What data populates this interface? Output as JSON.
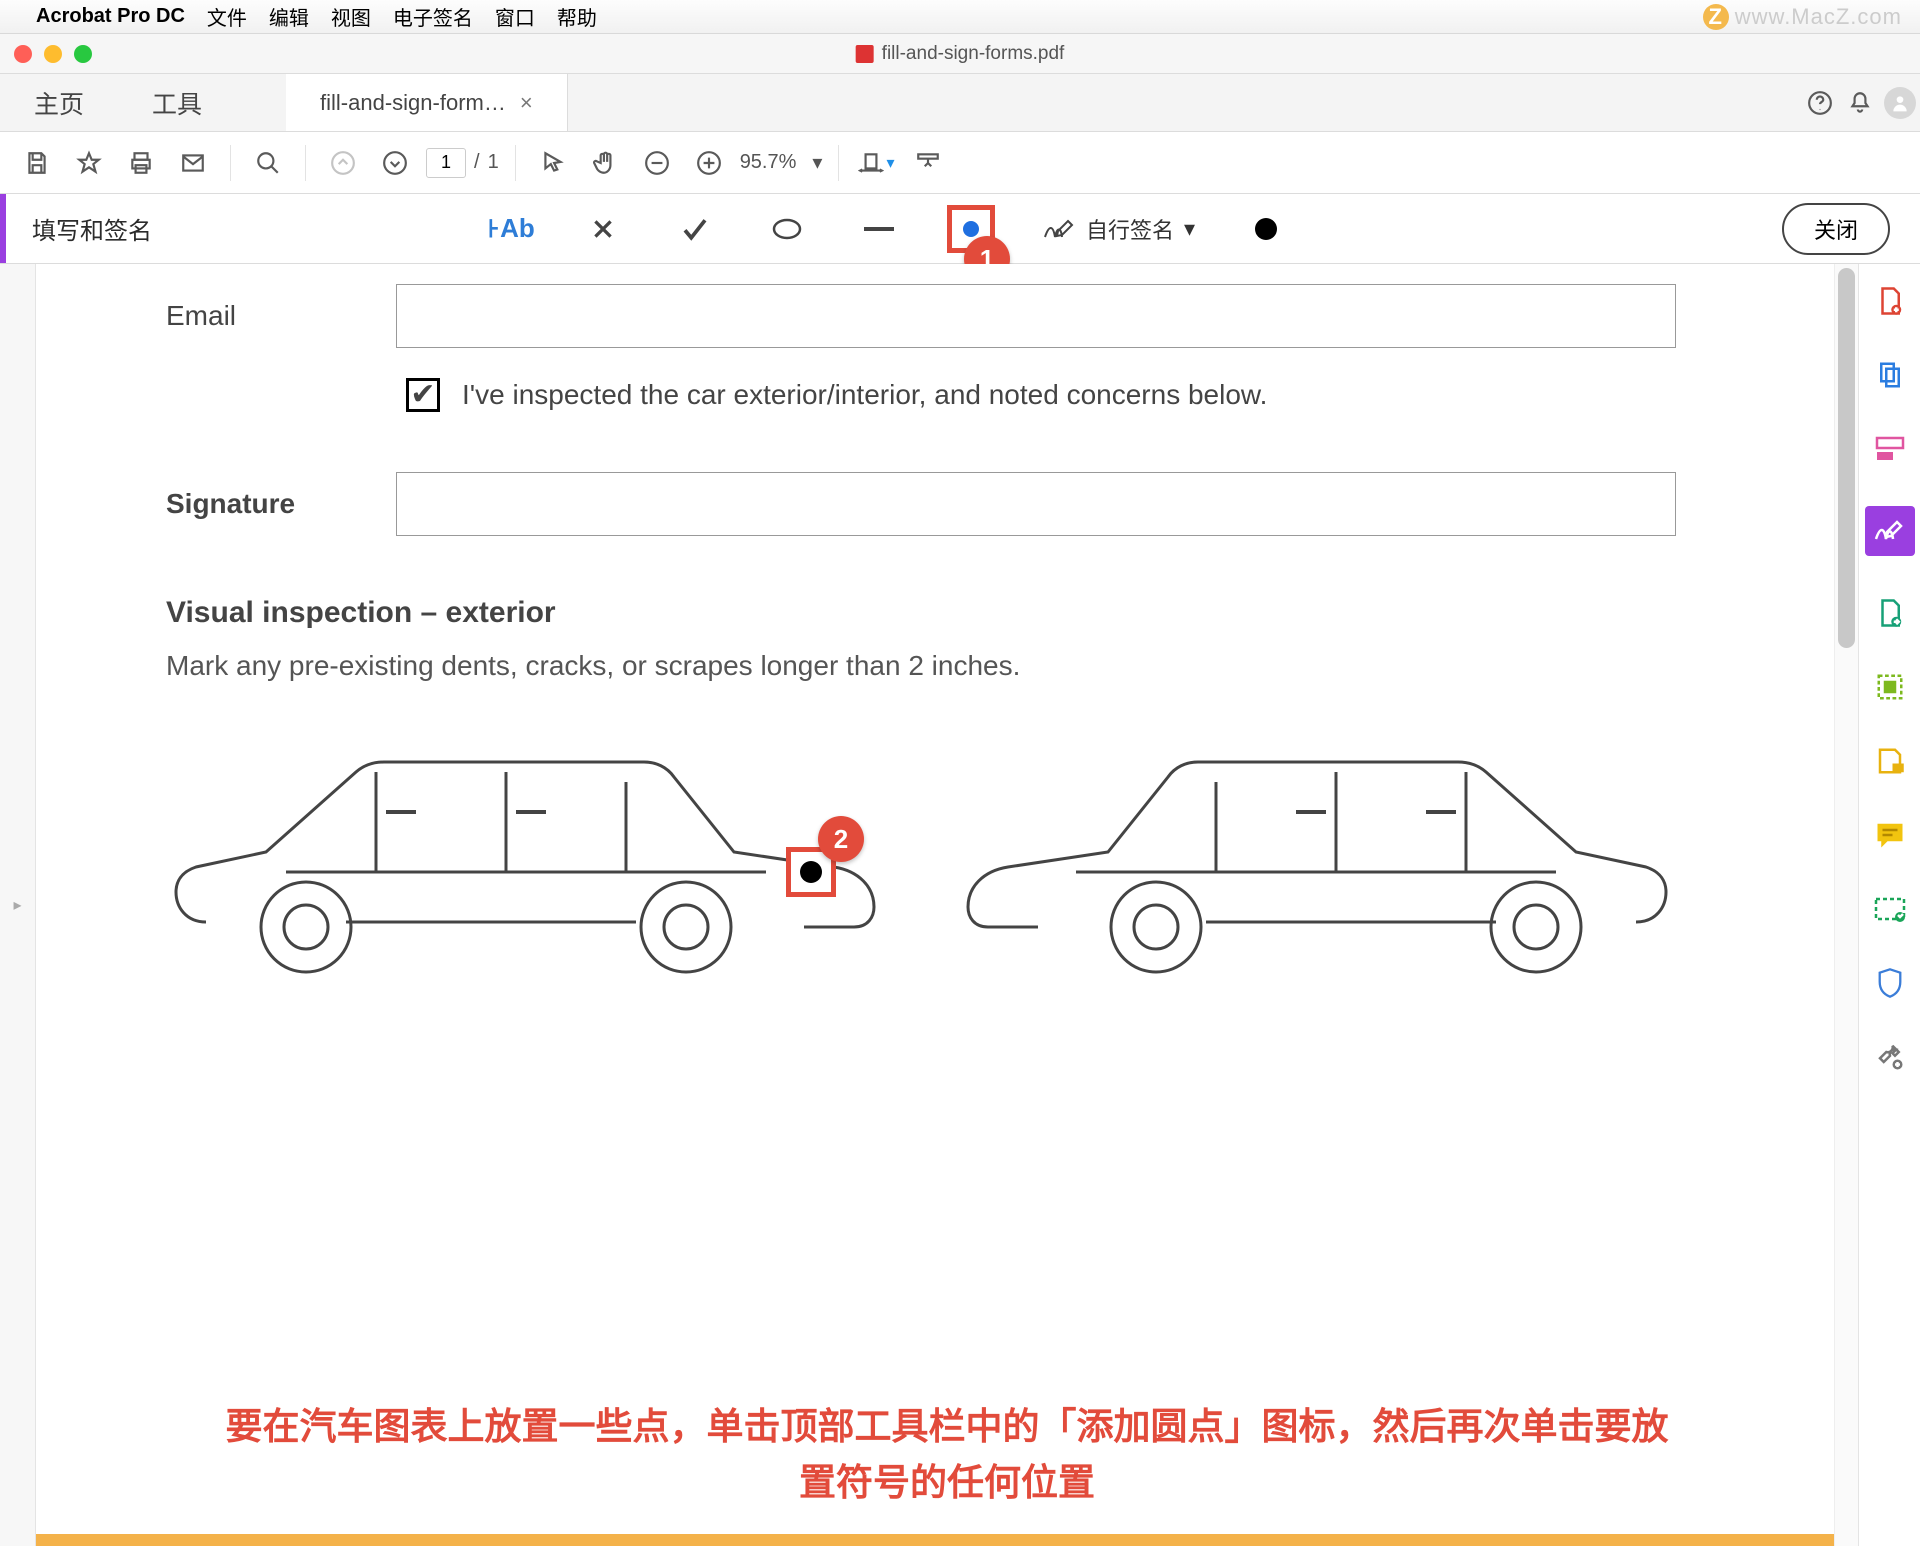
{
  "mac_menu": {
    "app": "Acrobat Pro DC",
    "items": [
      "文件",
      "编辑",
      "视图",
      "电子签名",
      "窗口",
      "帮助"
    ]
  },
  "watermark": "www.MacZ.com",
  "window_title": "fill-and-sign-forms.pdf",
  "tabs": {
    "home": "主页",
    "tools": "工具",
    "doc": "fill-and-sign-form…"
  },
  "toolbar": {
    "page_current": "1",
    "page_total": "1",
    "zoom": "95.7%"
  },
  "fs": {
    "title": "填写和签名",
    "self_sign": "自行签名",
    "close": "关闭",
    "callout1": "1"
  },
  "form": {
    "email_label": "Email",
    "checkbox_text": "I've inspected the car exterior/interior, and noted concerns below.",
    "signature_label": "Signature",
    "heading": "Visual inspection – exterior",
    "sub": "Mark any pre-existing dents, cracks, or scrapes longer than 2 inches.",
    "callout2": "2"
  },
  "caption_line1": "要在汽车图表上放置一些点，单击顶部工具栏中的「添加圆点」图标，然后再次单击要放",
  "caption_line2": "置符号的任何位置"
}
